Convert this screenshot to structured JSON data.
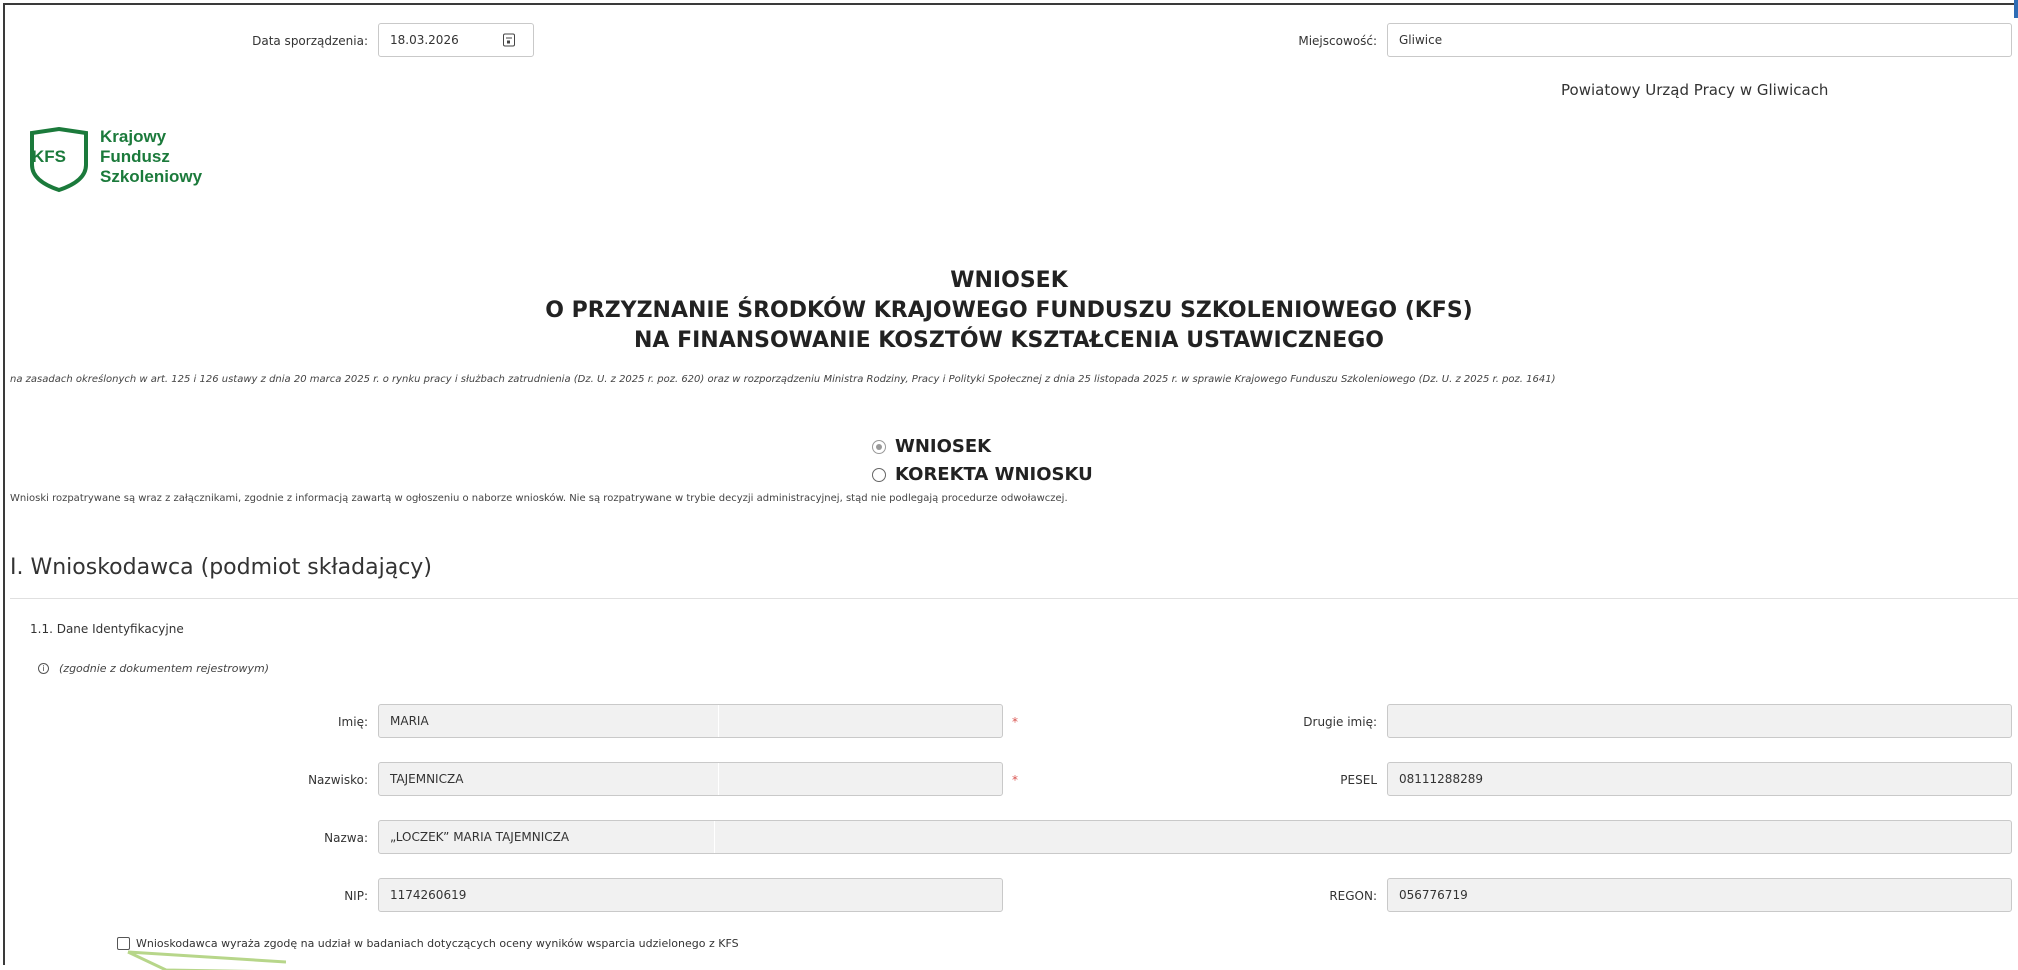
{
  "header": {
    "date_label": "Data sporządzenia:",
    "date_value": "18.03.2026",
    "place_label": "Miejscowość:",
    "place_value": "Gliwice",
    "office": "Powiatowy Urząd Pracy w Gliwicach"
  },
  "logo": {
    "short": "KFS",
    "line1": "Krajowy",
    "line2": "Fundusz",
    "line3": "Szkoleniowy",
    "color": "#1b7a3b"
  },
  "title": {
    "line1": "WNIOSEK",
    "line2": "O PRZYZNANIE ŚRODKÓW KRAJOWEGO FUNDUSZU SZKOLENIOWEGO (KFS)",
    "line3": "NA FINANSOWANIE KOSZTÓW KSZTAŁCENIA USTAWICZNEGO",
    "legal": "na zasadach określonych w art. 125 i 126 ustawy z dnia 20 marca 2025 r. o rynku pracy i służbach zatrudnienia (Dz. U. z 2025 r. poz. 620) oraz w rozporządzeniu Ministra Rodziny, Pracy i Polityki Społecznej z dnia 25 listopada 2025 r. w sprawie Krajowego Funduszu Szkoleniowego (Dz. U. z 2025 r. poz. 1641)"
  },
  "type_choice": {
    "options": [
      "WNIOSEK",
      "KOREKTA WNIOSKU"
    ],
    "selected": "WNIOSEK"
  },
  "note": "Wnioski rozpatrywane są wraz z załącznikami, zgodnie z informacją zawartą w ogłoszeniu o naborze wniosków. Nie są rozpatrywane w trybie decyzji administracyjnej, stąd nie podlegają procedurze odwoławczej.",
  "section": {
    "title": "I. Wnioskodawca (podmiot składający)",
    "subtitle": "1.1. Dane Identyfikacyjne",
    "hint": "(zgodnie z dokumentem rejestrowym)",
    "info_icon": "i"
  },
  "fields": {
    "imie_label": "Imię:",
    "imie_value": "MARIA",
    "drugie_imie_label": "Drugie imię:",
    "drugie_imie_value": "",
    "nazwisko_label": "Nazwisko:",
    "nazwisko_value": "TAJEMNICZA",
    "pesel_label": "PESEL",
    "pesel_value": "08111288289",
    "nazwa_label": "Nazwa:",
    "nazwa_value": "„LOCZEK” MARIA TAJEMNICZA",
    "nip_label": "NIP:",
    "nip_value": "1174260619",
    "regon_label": "REGON:",
    "regon_value": "056776719",
    "required_mark": "*"
  },
  "consent": {
    "label": "Wnioskodawca wyraża zgodę na udział w badaniach dotyczących oceny wyników wsparcia udzielonego z KFS",
    "checked": false
  },
  "colors": {
    "required": "#d9534f",
    "readonly_bg": "#f1f1f1",
    "annotation": "#b7d68a"
  }
}
